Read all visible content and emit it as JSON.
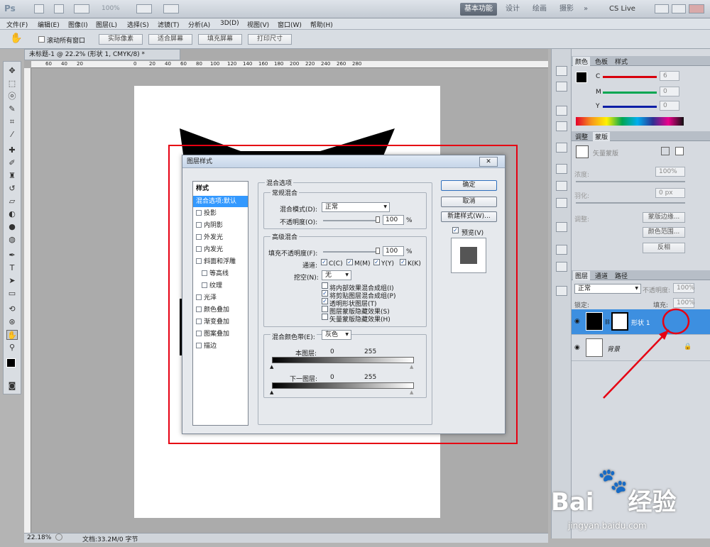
{
  "app": {
    "logo": "Ps",
    "zoom_combo": "100%",
    "workspaces": [
      "基本功能",
      "设计",
      "绘画",
      "摄影"
    ],
    "more": "»",
    "cslive": "CS Live"
  },
  "menu": [
    "文件(F)",
    "编辑(E)",
    "图像(I)",
    "图层(L)",
    "选择(S)",
    "滤镜(T)",
    "分析(A)",
    "3D(D)",
    "视图(V)",
    "窗口(W)",
    "帮助(H)"
  ],
  "options": {
    "scroll_all": "滚动所有窗口",
    "buttons": [
      "实际像素",
      "适合屏幕",
      "填充屏幕",
      "打印尺寸"
    ]
  },
  "document": {
    "tab_title": "未标题-1 @ 22.2% (形状 1, CMYK/8) *",
    "ruler_marks": [
      "60",
      "40",
      "20",
      "0",
      "20",
      "40",
      "60",
      "80",
      "100",
      "120",
      "140",
      "160",
      "180",
      "200",
      "220",
      "240",
      "260",
      "280"
    ],
    "status_zoom": "22.18%",
    "status_doc": "文档:33.2M/0 字节"
  },
  "color_panel": {
    "tabs": [
      "颜色",
      "色板",
      "样式"
    ],
    "channels": [
      {
        "label": "C",
        "value": "6",
        "color": "#d8000c"
      },
      {
        "label": "M",
        "value": "0",
        "color": "#00a651"
      },
      {
        "label": "Y",
        "value": "0",
        "color": "#0d1ea6"
      }
    ]
  },
  "adjust_panel": {
    "tabs": [
      "调整",
      "蒙版"
    ],
    "mask_label": "矢量蒙版",
    "density_label": "浓度:",
    "density_value": "100%",
    "feather_label": "羽化:",
    "feather_value": "0 px",
    "refine_label": "调整:",
    "buttons": [
      "蒙版边缘...",
      "颜色范围...",
      "反相"
    ]
  },
  "layers_panel": {
    "tabs": [
      "图层",
      "通道",
      "路径"
    ],
    "blend": "正常",
    "opacity_label": "不透明度:",
    "opacity_value": "100%",
    "lock_label": "锁定:",
    "fill_label": "填充:",
    "fill_value": "100%",
    "layers": [
      {
        "name": "形状 1",
        "selected": true
      },
      {
        "name": "背景",
        "selected": false
      }
    ]
  },
  "dialog": {
    "title": "图层样式",
    "close": "✕",
    "style_header": "样式",
    "styles": [
      {
        "label": "混合选项:默认",
        "selected": true,
        "checkbox": false,
        "indent": false
      },
      {
        "label": "投影",
        "selected": false,
        "checkbox": true,
        "indent": false
      },
      {
        "label": "内阴影",
        "selected": false,
        "checkbox": true,
        "indent": false
      },
      {
        "label": "外发光",
        "selected": false,
        "checkbox": true,
        "indent": false
      },
      {
        "label": "内发光",
        "selected": false,
        "checkbox": true,
        "indent": false
      },
      {
        "label": "斜面和浮雕",
        "selected": false,
        "checkbox": true,
        "indent": false
      },
      {
        "label": "等高线",
        "selected": false,
        "checkbox": true,
        "indent": true
      },
      {
        "label": "纹理",
        "selected": false,
        "checkbox": true,
        "indent": true
      },
      {
        "label": "光泽",
        "selected": false,
        "checkbox": true,
        "indent": false
      },
      {
        "label": "颜色叠加",
        "selected": false,
        "checkbox": true,
        "indent": false
      },
      {
        "label": "渐变叠加",
        "selected": false,
        "checkbox": true,
        "indent": false
      },
      {
        "label": "图案叠加",
        "selected": false,
        "checkbox": true,
        "indent": false
      },
      {
        "label": "描边",
        "selected": false,
        "checkbox": true,
        "indent": false
      }
    ],
    "blend_options_title": "混合选项",
    "general_title": "常规混合",
    "blend_mode_label": "混合模式(D):",
    "blend_mode_value": "正常",
    "opacity_label": "不透明度(O):",
    "opacity_value": "100",
    "percent": "%",
    "advanced_title": "高级混合",
    "fill_opacity_label": "填充不透明度(F):",
    "fill_opacity_value": "100",
    "channels_label": "通道:",
    "channels": [
      "C(C)",
      "M(M)",
      "Y(Y)",
      "K(K)"
    ],
    "knockout_label": "挖空(N):",
    "knockout_value": "无",
    "advanced_checks": [
      {
        "label": "将内部效果混合成组(I)",
        "checked": false
      },
      {
        "label": "将剪贴图层混合成组(P)",
        "checked": true
      },
      {
        "label": "透明形状图层(T)",
        "checked": true
      },
      {
        "label": "图层蒙版隐藏效果(S)",
        "checked": false
      },
      {
        "label": "矢量蒙版隐藏效果(H)",
        "checked": false
      }
    ],
    "blend_if_label": "混合颜色带(E):",
    "blend_if_value": "灰色",
    "this_layer_label": "本图层:",
    "below_layer_label": "下一图层:",
    "range_low": "0",
    "range_high": "255",
    "ok": "确定",
    "cancel": "取消",
    "new_style": "新建样式(W)...",
    "preview": "预览(V)"
  },
  "watermark": {
    "brand": "Bai",
    "brand_cn": "经验",
    "url": "jingyan.baidu.com"
  }
}
